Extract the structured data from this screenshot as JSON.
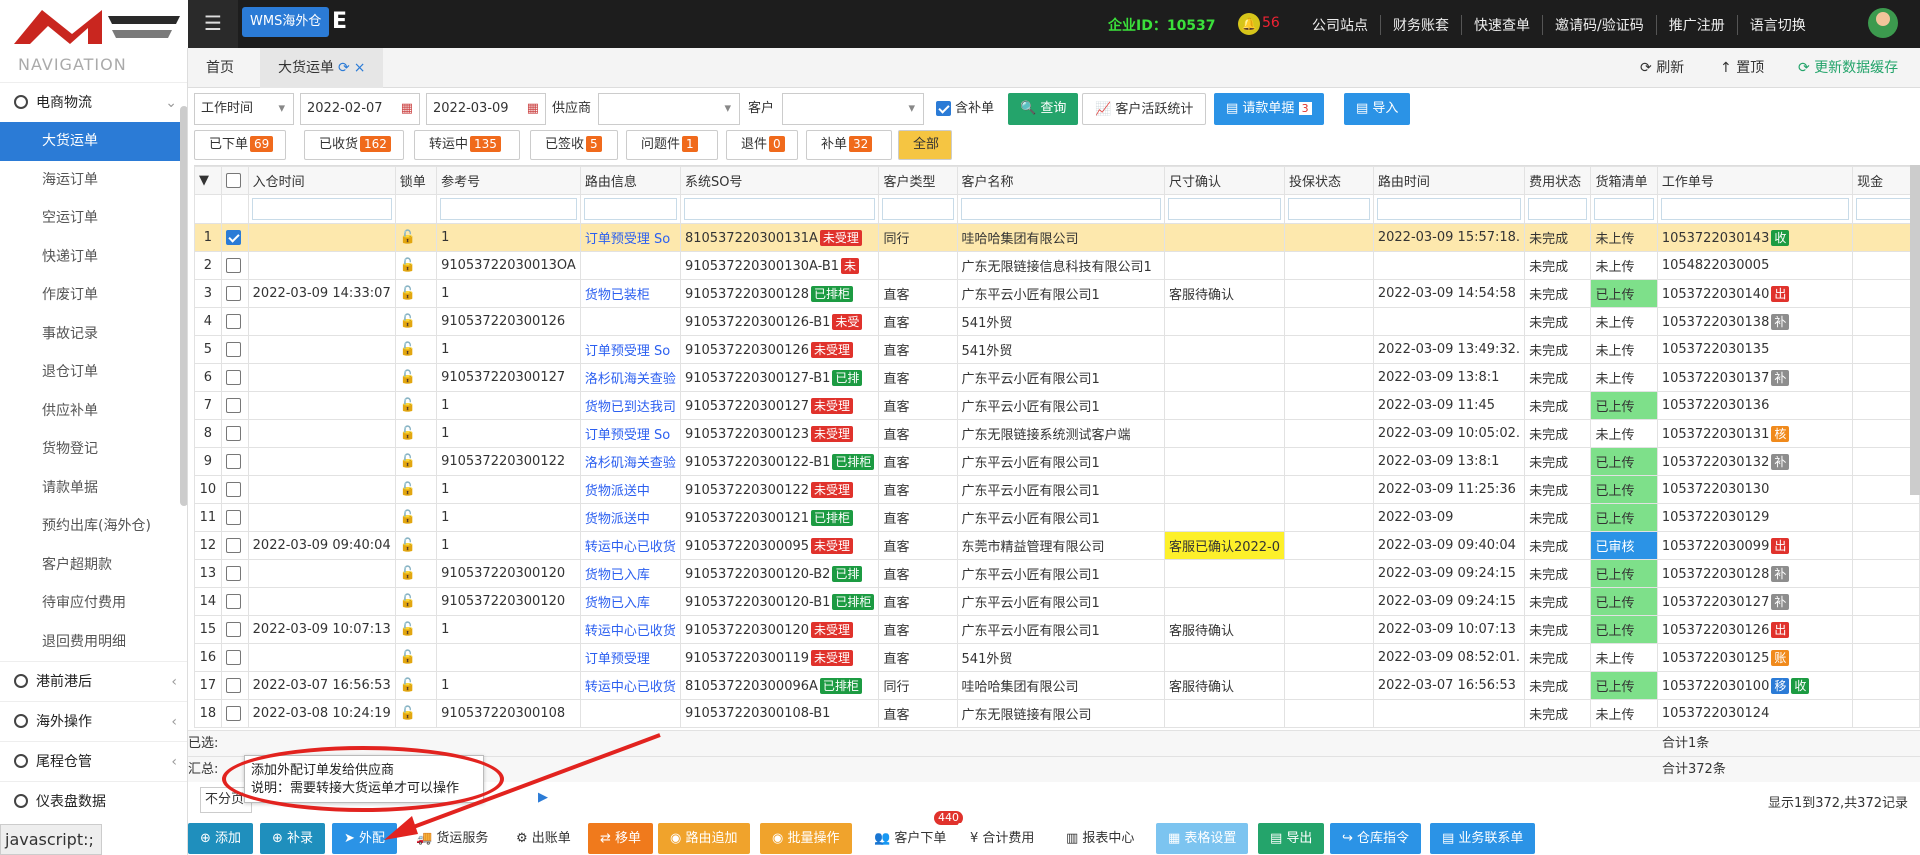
{
  "header": {
    "brand": "WMS海外仓",
    "brand_suffix": "E",
    "corp_id": "企业ID：10537",
    "notify_count": "56",
    "links": [
      "公司站点",
      "财务账套",
      "快速查单",
      "邀请码/验证码",
      "推广注册",
      "语言切换"
    ]
  },
  "sidebar": {
    "title": "NAVIGATION",
    "group1": "电商物流",
    "items": [
      "大货运单",
      "海运订单",
      "空运订单",
      "快递订单",
      "作废订单",
      "事故记录",
      "退仓订单",
      "供应补单",
      "货物登记",
      "请款单据",
      "预约出库(海外仓)",
      "客户超期款",
      "待审应付费用",
      "退回费用明细"
    ],
    "groups": [
      "港前港后",
      "海外操作",
      "尾程仓管",
      "仪表盘数据"
    ]
  },
  "tabs": {
    "home": "首页",
    "current": "大货运单",
    "refresh": "刷新",
    "top": "置顶",
    "update_cache": "更新数据缓存"
  },
  "filters": {
    "time_type": "工作时间",
    "date_from": "2022-02-07",
    "date_to": "2022-03-09",
    "supplier_label": "供应商",
    "customer_label": "客户",
    "include_supplement": "含补单",
    "query": "查询",
    "customer_stats": "客户活跃统计",
    "request_docs": "请款单据",
    "request_docs_count": "3",
    "import": "导入"
  },
  "status": [
    {
      "label": "已下单",
      "count": "69"
    },
    {
      "label": "已收货",
      "count": "162"
    },
    {
      "label": "转运中",
      "count": "135"
    },
    {
      "label": "已签收",
      "count": "5"
    },
    {
      "label": "问题件",
      "count": "1"
    },
    {
      "label": "退件",
      "count": "0"
    },
    {
      "label": "补单",
      "count": "32"
    },
    {
      "label": "全部",
      "count": ""
    }
  ],
  "columns": [
    "入仓时间",
    "锁单",
    "参考号",
    "路由信息",
    "系统SO号",
    "客户类型",
    "客户名称",
    "尺寸确认",
    "投保状态",
    "路由时间",
    "费用状态",
    "货箱清单",
    "工作单号",
    "现金"
  ],
  "rows": [
    {
      "n": "1",
      "time": "",
      "ref": "1",
      "route": "订单预受理 So",
      "so": "810537220300131A",
      "sotag": "未受理",
      "sotc": "red",
      "ctype": "同行",
      "cname": "哇哈哈集团有限公司",
      "size": "",
      "rtime": "2022-03-09 15:57:18.",
      "fee": "未完成",
      "box": "未上传",
      "boxc": "",
      "wo": "1053722030143",
      "wotag": "收",
      "wotc": "green",
      "wotag2": "",
      "sel": true
    },
    {
      "n": "2",
      "time": "",
      "ref": "91053722030013OA",
      "route": "",
      "so": "910537220300130A-B1",
      "sotag": "未",
      "sotc": "red",
      "ctype": "",
      "cname": "广东无限链接信息科技有限公司1",
      "size": "",
      "rtime": "",
      "fee": "未完成",
      "box": "未上传",
      "boxc": "",
      "wo": "1054822030005",
      "wotag": "",
      "wotc": "",
      "wotag2": "",
      "sel": false
    },
    {
      "n": "3",
      "time": "2022-03-09 14:33:07",
      "ref": "1",
      "route": "货物已装柜",
      "so": "910537220300128",
      "sotag": "已排柜",
      "sotc": "green",
      "ctype": "直客",
      "cname": "广东平云小匠有限公司1",
      "size": "客服待确认",
      "rtime": "2022-03-09 14:54:58",
      "fee": "未完成",
      "box": "已上传",
      "boxc": "up",
      "wo": "1053722030140",
      "wotag": "出",
      "wotc": "red",
      "wotag2": "",
      "sel": false
    },
    {
      "n": "4",
      "time": "",
      "ref": "910537220300126",
      "route": "",
      "so": "910537220300126-B1",
      "sotag": "未受",
      "sotc": "red",
      "ctype": "直客",
      "cname": "541外贸",
      "size": "",
      "rtime": "",
      "fee": "未完成",
      "box": "未上传",
      "boxc": "",
      "wo": "1053722030138",
      "wotag": "补",
      "wotc": "gray",
      "wotag2": "",
      "sel": false
    },
    {
      "n": "5",
      "time": "",
      "ref": "1",
      "route": "订单预受理 So",
      "so": "910537220300126",
      "sotag": "未受理",
      "sotc": "red",
      "ctype": "直客",
      "cname": "541外贸",
      "size": "",
      "rtime": "2022-03-09 13:49:32.",
      "fee": "未完成",
      "box": "未上传",
      "boxc": "",
      "wo": "1053722030135",
      "wotag": "",
      "wotc": "",
      "wotag2": "",
      "sel": false
    },
    {
      "n": "6",
      "time": "",
      "ref": "910537220300127",
      "route": "洛杉矶海关查验",
      "so": "910537220300127-B1",
      "sotag": "已排",
      "sotc": "green",
      "ctype": "直客",
      "cname": "广东平云小匠有限公司1",
      "size": "",
      "rtime": "2022-03-09 13:8:1",
      "fee": "未完成",
      "box": "未上传",
      "boxc": "",
      "wo": "1053722030137",
      "wotag": "补",
      "wotc": "gray",
      "wotag2": "",
      "sel": false
    },
    {
      "n": "7",
      "time": "",
      "ref": "1",
      "route": "货物已到达我司",
      "so": "910537220300127",
      "sotag": "未受理",
      "sotc": "red",
      "ctype": "直客",
      "cname": "广东平云小匠有限公司1",
      "size": "",
      "rtime": "2022-03-09 11:45",
      "fee": "未完成",
      "box": "已上传",
      "boxc": "up",
      "wo": "1053722030136",
      "wotag": "",
      "wotc": "",
      "wotag2": "",
      "sel": false
    },
    {
      "n": "8",
      "time": "",
      "ref": "1",
      "route": "订单预受理 So",
      "so": "910537220300123",
      "sotag": "未受理",
      "sotc": "red",
      "ctype": "直客",
      "cname": "广东无限链接系统测试客户端",
      "size": "",
      "rtime": "2022-03-09 10:05:02.",
      "fee": "未完成",
      "box": "未上传",
      "boxc": "",
      "wo": "1053722030131",
      "wotag": "核",
      "wotc": "orange",
      "wotag2": "",
      "sel": false
    },
    {
      "n": "9",
      "time": "",
      "ref": "910537220300122",
      "route": "洛杉矶海关查验",
      "so": "910537220300122-B1",
      "sotag": "已排柜",
      "sotc": "green",
      "ctype": "直客",
      "cname": "广东平云小匠有限公司1",
      "size": "",
      "rtime": "2022-03-09 13:8:1",
      "fee": "未完成",
      "box": "已上传",
      "boxc": "up",
      "wo": "1053722030132",
      "wotag": "补",
      "wotc": "gray",
      "wotag2": "",
      "sel": false
    },
    {
      "n": "10",
      "time": "",
      "ref": "1",
      "route": "货物派送中",
      "so": "910537220300122",
      "sotag": "未受理",
      "sotc": "red",
      "ctype": "直客",
      "cname": "广东平云小匠有限公司1",
      "size": "",
      "rtime": "2022-03-09 11:25:36",
      "fee": "未完成",
      "box": "已上传",
      "boxc": "up",
      "wo": "1053722030130",
      "wotag": "",
      "wotc": "",
      "wotag2": "",
      "sel": false
    },
    {
      "n": "11",
      "time": "",
      "ref": "1",
      "route": "货物派送中",
      "so": "910537220300121",
      "sotag": "已排柜",
      "sotc": "green",
      "ctype": "直客",
      "cname": "广东平云小匠有限公司1",
      "size": "",
      "rtime": "2022-03-09",
      "fee": "未完成",
      "box": "已上传",
      "boxc": "up",
      "wo": "1053722030129",
      "wotag": "",
      "wotc": "",
      "wotag2": "",
      "sel": false
    },
    {
      "n": "12",
      "time": "2022-03-09 09:40:04",
      "ref": "1",
      "route": "转运中心已收货",
      "so": "910537220300095",
      "sotag": "未受理",
      "sotc": "red",
      "ctype": "直客",
      "cname": "东莞市精益管理有限公司",
      "size": "客服已确认2022-0",
      "rtime": "2022-03-09 09:40:04",
      "fee": "未完成",
      "box": "已审核",
      "boxc": "audit",
      "wo": "1053722030099",
      "wotag": "出",
      "wotc": "red",
      "wotag2": "",
      "sel": false
    },
    {
      "n": "13",
      "time": "",
      "ref": "910537220300120",
      "route": "货物已入库",
      "so": "910537220300120-B2",
      "sotag": "已排",
      "sotc": "green",
      "ctype": "直客",
      "cname": "广东平云小匠有限公司1",
      "size": "",
      "rtime": "2022-03-09 09:24:15",
      "fee": "未完成",
      "box": "已上传",
      "boxc": "up",
      "wo": "1053722030128",
      "wotag": "补",
      "wotc": "gray",
      "wotag2": "",
      "sel": false
    },
    {
      "n": "14",
      "time": "",
      "ref": "910537220300120",
      "route": "货物已入库",
      "so": "910537220300120-B1",
      "sotag": "已排柜",
      "sotc": "green",
      "ctype": "直客",
      "cname": "广东平云小匠有限公司1",
      "size": "",
      "rtime": "2022-03-09 09:24:15",
      "fee": "未完成",
      "box": "已上传",
      "boxc": "up",
      "wo": "1053722030127",
      "wotag": "补",
      "wotc": "gray",
      "wotag2": "",
      "sel": false
    },
    {
      "n": "15",
      "time": "2022-03-09 10:07:13",
      "ref": "1",
      "route": "转运中心已收货",
      "so": "910537220300120",
      "sotag": "未受理",
      "sotc": "red",
      "ctype": "直客",
      "cname": "广东平云小匠有限公司1",
      "size": "客服待确认",
      "rtime": "2022-03-09 10:07:13",
      "fee": "未完成",
      "box": "已上传",
      "boxc": "up",
      "wo": "1053722030126",
      "wotag": "出",
      "wotc": "red",
      "wotag2": "",
      "sel": false
    },
    {
      "n": "16",
      "time": "",
      "ref": "",
      "route": "订单预受理",
      "so": "910537220300119",
      "sotag": "未受理",
      "sotc": "red",
      "ctype": "直客",
      "cname": "541外贸",
      "size": "",
      "rtime": "2022-03-09 08:52:01.",
      "fee": "未完成",
      "box": "未上传",
      "boxc": "",
      "wo": "1053722030125",
      "wotag": "账",
      "wotc": "orange",
      "wotag2": "",
      "sel": false
    },
    {
      "n": "17",
      "time": "2022-03-07 16:56:53",
      "ref": "1",
      "route": "转运中心已收货",
      "so": "810537220300096A",
      "sotag": "已排柜",
      "sotc": "green",
      "ctype": "同行",
      "cname": "哇哈哈集团有限公司",
      "size": "客服待确认",
      "rtime": "2022-03-07 16:56:53",
      "fee": "未完成",
      "box": "已上传",
      "boxc": "up",
      "wo": "1053722030100",
      "wotag": "移",
      "wotc": "blue",
      "wotag2": "收",
      "sel": false
    },
    {
      "n": "18",
      "time": "2022-03-08 10:24:19",
      "ref": "910537220300108",
      "route": "",
      "so": "910537220300108-B1",
      "sotag": "",
      "sotc": "",
      "ctype": "直客",
      "cname": "广东无限链接有限公司",
      "size": "",
      "rtime": "",
      "fee": "未完成",
      "box": "未上传",
      "boxc": "",
      "wo": "1053722030124",
      "wotag": "",
      "wotc": "",
      "wotag2": "",
      "sel": false
    }
  ],
  "summary": {
    "selected_label": "已选:",
    "total_label": "汇总:",
    "selected_count": "合计1条",
    "total_count": "合计372条"
  },
  "pager": {
    "select": "不分页",
    "info": "显示1到372,共372记录"
  },
  "tooltip": {
    "line1": "添加外配订单发给供应商",
    "line2": "说明：需要转接大货运单才可以操作"
  },
  "status_bar": "javascript:;",
  "bottom": {
    "add": "添加",
    "supplement": "补录",
    "outsource": "外配",
    "freight": "货运服务",
    "bill": "出账单",
    "move": "移单",
    "route_add": "路由追加",
    "batch": "批量操作",
    "customer_order": "客户下单",
    "customer_order_count": "440",
    "total_fee": "合计费用",
    "reports": "报表中心",
    "table_settings": "表格设置",
    "export": "导出",
    "warehouse_cmd": "仓库指令",
    "business_sheet": "业务联系单"
  },
  "colors": {
    "accent_blue": "#2b7bd6",
    "corp_green": "#3be03b",
    "annotation_red": "#e2231f"
  }
}
